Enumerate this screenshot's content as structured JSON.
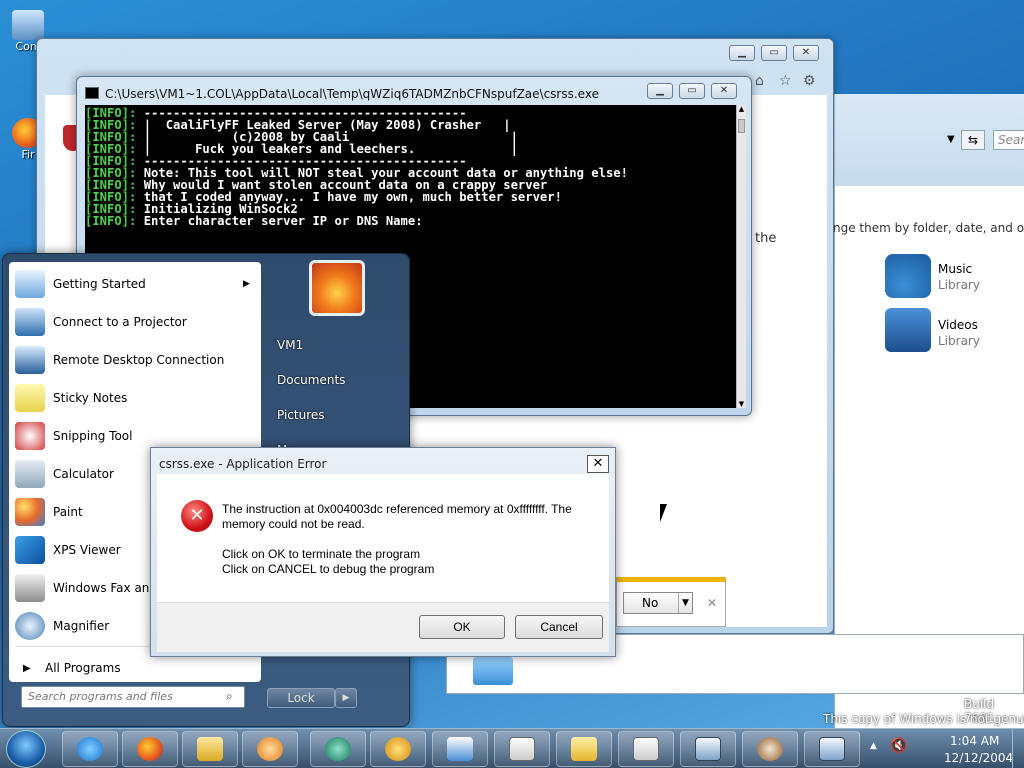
{
  "desktop": {
    "icons": [
      {
        "label": "Com",
        "icon": "computer-icon"
      },
      {
        "label": "Fir",
        "icon": "firefox-icon"
      }
    ]
  },
  "console": {
    "title": "C:\\Users\\VM1~1.COL\\AppData\\Local\\Temp\\qWZiq6TADMZnbCFNspufZae\\csrss.exe",
    "lines": [
      {
        "tag": "[INFO]:",
        "text": " --------------------------------------------"
      },
      {
        "tag": "[INFO]:",
        "text": " |  CaaliFlyFF Leaked Server (May 2008) Crasher   |"
      },
      {
        "tag": "[INFO]:",
        "text": " |           (c)2008 by Caali                      |"
      },
      {
        "tag": "[INFO]:",
        "text": " |      Fuck you leakers and leechers.             |"
      },
      {
        "tag": "[INFO]:",
        "text": " --------------------------------------------"
      },
      {
        "tag": "[INFO]:",
        "text": " Note: This tool will NOT steal your account data or anything else!"
      },
      {
        "tag": "[INFO]:",
        "text": " Why would I want stolen account data on a crappy server"
      },
      {
        "tag": "[INFO]:",
        "text": " that I coded anyway... I have my own, much better server!"
      },
      {
        "tag": "[INFO]:",
        "text": " Initializing WinSock2"
      },
      {
        "tag": "[INFO]:",
        "text": " Enter character server IP or DNS Name:"
      }
    ]
  },
  "explorer": {
    "search_placeholder": "Sear",
    "partial_text_left": "the",
    "partial_text_right": "nge them by folder, date, and other",
    "libraries": [
      {
        "name": "Music",
        "sub": "Library",
        "icon": "music-library-icon"
      },
      {
        "name": "Videos",
        "sub": "Library",
        "icon": "videos-library-icon"
      }
    ]
  },
  "prompt_bar": {
    "value": "No"
  },
  "start_menu": {
    "programs": [
      {
        "label": "Getting Started",
        "icon": "getting-started-icon",
        "submenu": true
      },
      {
        "label": "Connect to a Projector",
        "icon": "projector-icon"
      },
      {
        "label": "Remote Desktop Connection",
        "icon": "remote-desktop-icon"
      },
      {
        "label": "Sticky Notes",
        "icon": "sticky-notes-icon"
      },
      {
        "label": "Snipping Tool",
        "icon": "snipping-tool-icon"
      },
      {
        "label": "Calculator",
        "icon": "calculator-icon"
      },
      {
        "label": "Paint",
        "icon": "paint-icon"
      },
      {
        "label": "XPS Viewer",
        "icon": "xps-viewer-icon"
      },
      {
        "label": "Windows Fax and S",
        "icon": "fax-icon"
      },
      {
        "label": "Magnifier",
        "icon": "magnifier-icon"
      }
    ],
    "all_programs": "All Programs",
    "search_placeholder": "Search programs and files",
    "right_items": [
      "VM1",
      "Documents",
      "Pictures",
      "Mu"
    ],
    "lock_label": "Lock"
  },
  "dialog": {
    "title": "csrss.exe - Application Error",
    "message": "The instruction at 0x004003dc referenced memory at 0xffffffff. The memory could not be read.",
    "line_ok": "Click on OK to terminate the program",
    "line_cancel": "Click on CANCEL to debug the program",
    "ok_label": "OK",
    "cancel_label": "Cancel",
    "close_glyph": "✕"
  },
  "watermark": {
    "build": "Build 7601",
    "notice": "This copy of Windows is not genuine"
  },
  "taskbar": {
    "time": "1:04 AM",
    "date": "12/12/2004",
    "items": [
      "internet-explorer-icon",
      "firefox-icon",
      "explorer-icon",
      "media-player-icon",
      "app-icon",
      "medal-app-icon",
      "ie-document-icon",
      "exe-icon",
      "folder-icon",
      "exe-icon-2",
      "window-icon",
      "coffee-icon",
      "window-icon-2"
    ]
  }
}
